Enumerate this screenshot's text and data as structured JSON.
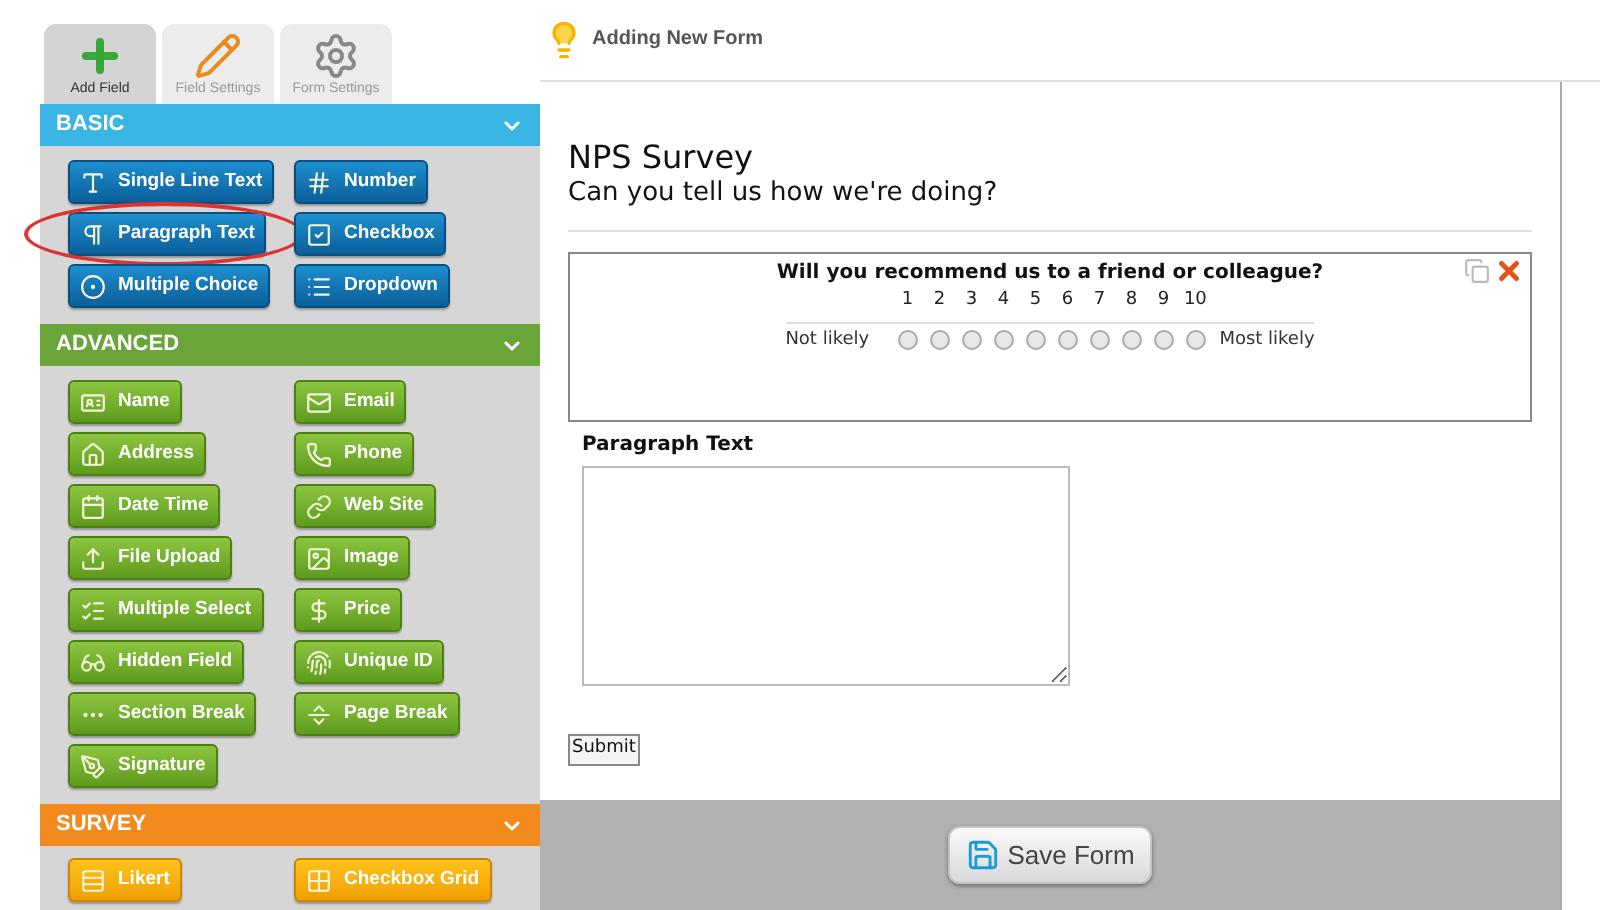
{
  "tabs": [
    {
      "label": "Add Field",
      "selected": true
    },
    {
      "label": "Field Settings",
      "selected": false
    },
    {
      "label": "Form Settings",
      "selected": false
    }
  ],
  "header": {
    "title": "Adding New Form"
  },
  "sections": [
    {
      "title": "BASIC",
      "color": "#3ab5e3",
      "items": [
        {
          "label": "Single Line Text",
          "circled": false
        },
        {
          "label": "Number",
          "circled": false
        },
        {
          "label": "Paragraph Text",
          "circled": true
        },
        {
          "label": "Checkbox",
          "circled": false
        },
        {
          "label": "Multiple Choice",
          "circled": false
        },
        {
          "label": "Dropdown",
          "circled": false
        }
      ]
    },
    {
      "title": "ADVANCED",
      "color": "#6aa53a",
      "items": [
        "Name",
        "Email",
        "Address",
        "Phone",
        "Date Time",
        "Web Site",
        "File Upload",
        "Image",
        "Multiple Select",
        "Price",
        "Hidden Field",
        "Unique ID",
        "Section Break",
        "Page Break",
        "Signature"
      ]
    },
    {
      "title": "SURVEY",
      "color": "#f28a1e",
      "items": [
        "Likert",
        "Checkbox Grid"
      ]
    }
  ],
  "form": {
    "title": "NPS Survey",
    "subtitle": "Can you tell us how we're doing?",
    "nps": {
      "question": "Will you recommend us to a friend or colleague?",
      "low_label": "Not likely",
      "high_label": "Most likely",
      "options": [
        {
          "label": "1",
          "selected": false
        },
        {
          "label": "2",
          "selected": false
        },
        {
          "label": "3",
          "selected": false
        },
        {
          "label": "4",
          "selected": false
        },
        {
          "label": "5",
          "selected": false
        },
        {
          "label": "6",
          "selected": false
        },
        {
          "label": "7",
          "selected": false
        },
        {
          "label": "8",
          "selected": false
        },
        {
          "label": "9",
          "selected": false
        },
        {
          "label": "10",
          "selected": false
        }
      ]
    },
    "paragraph": {
      "label": "Paragraph Text"
    },
    "submit": "Submit"
  },
  "save_button": "Save Form"
}
